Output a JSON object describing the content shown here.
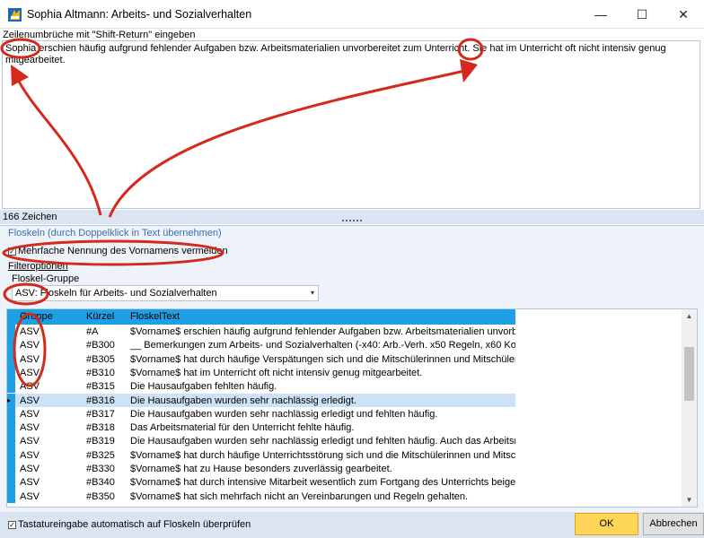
{
  "window": {
    "title": "Sophia Altmann: Arbeits- und Sozialverhalten",
    "minimize": "—",
    "maximize": "☐",
    "close": "✕"
  },
  "editor": {
    "hint": "Zeilenumbrüche mit \"Shift-Return\" eingeben",
    "text": "Sophia erschien häufig aufgrund fehlender Aufgaben bzw. Arbeitsmaterialien unvorbereitet zum Unterricht. Sie hat im Unterricht oft nicht intensiv genug mitgearbeitet.",
    "char_count": "166 Zeichen"
  },
  "floskeln": {
    "title": "Floskeln (durch Doppelklick in Text übernehmen)",
    "avoid_repeat_label": "Mehrfache Nennung des Vornamens vermeiden",
    "avoid_repeat_checked": true,
    "filter_label": "Filteroptionen",
    "group_label": "Floskel-Gruppe",
    "group_value": "ASV: Floskeln für Arbeits- und Sozialverhalten",
    "columns": [
      "Gruppe",
      "Kürzel",
      "FloskelText"
    ],
    "rows": [
      {
        "gruppe": "ASV",
        "kuerzel": "#A",
        "text": "$Vorname$ erschien häufig aufgrund fehlender Aufgaben bzw. Arbeitsmaterialien unvorber"
      },
      {
        "gruppe": "ASV",
        "kuerzel": "#B300",
        "text": "__ Bemerkungen zum Arbeits- und Sozialverhalten (-x40: Arb.-Verh.  x50 Regeln, x60 Konf"
      },
      {
        "gruppe": "ASV",
        "kuerzel": "#B305",
        "text": "$Vorname$ hat durch häufige Verspätungen sich und die Mitschülerinnen und Mitschüler in"
      },
      {
        "gruppe": "ASV",
        "kuerzel": "#B310",
        "text": "$Vorname$ hat im Unterricht oft nicht intensiv genug mitgearbeitet."
      },
      {
        "gruppe": "ASV",
        "kuerzel": "#B315",
        "text": "Die Hausaufgaben fehlten häufig."
      },
      {
        "gruppe": "ASV",
        "kuerzel": "#B316",
        "text": "Die Hausaufgaben wurden sehr nachlässig erledigt."
      },
      {
        "gruppe": "ASV",
        "kuerzel": "#B317",
        "text": "Die Hausaufgaben wurden sehr nachlässig erledigt und fehlten häufig."
      },
      {
        "gruppe": "ASV",
        "kuerzel": "#B318",
        "text": "Das Arbeitsmaterial für den Unterricht fehlte häufig."
      },
      {
        "gruppe": "ASV",
        "kuerzel": "#B319",
        "text": "Die Hausaufgaben wurden sehr nachlässig erledigt und fehlten häufig. Auch das Arbeitsma"
      },
      {
        "gruppe": "ASV",
        "kuerzel": "#B325",
        "text": "$Vorname$ hat durch häufige Unterrichtsstörung sich und die Mitschülerinnen und Mitschü"
      },
      {
        "gruppe": "ASV",
        "kuerzel": "#B330",
        "text": "$Vorname$ hat zu Hause besonders zuverlässig gearbeitet."
      },
      {
        "gruppe": "ASV",
        "kuerzel": "#B340",
        "text": "$Vorname$ hat durch intensive Mitarbeit wesentlich zum Fortgang des Unterrichts beigetra"
      },
      {
        "gruppe": "ASV",
        "kuerzel": "#B350",
        "text": "$Vorname$ hat sich mehrfach nicht an Vereinbarungen und Regeln gehalten."
      }
    ],
    "selected_row": 5
  },
  "footer": {
    "auto_check_label": "Tastatureingabe automatisch auf Floskeln überprüfen",
    "auto_check_checked": true,
    "ok_label": "OK",
    "cancel_label": "Abbrechen"
  },
  "colors": {
    "header_blue": "#1fa0e4",
    "annotation_red": "#d42a1c",
    "ok_yellow": "#ffd659"
  }
}
